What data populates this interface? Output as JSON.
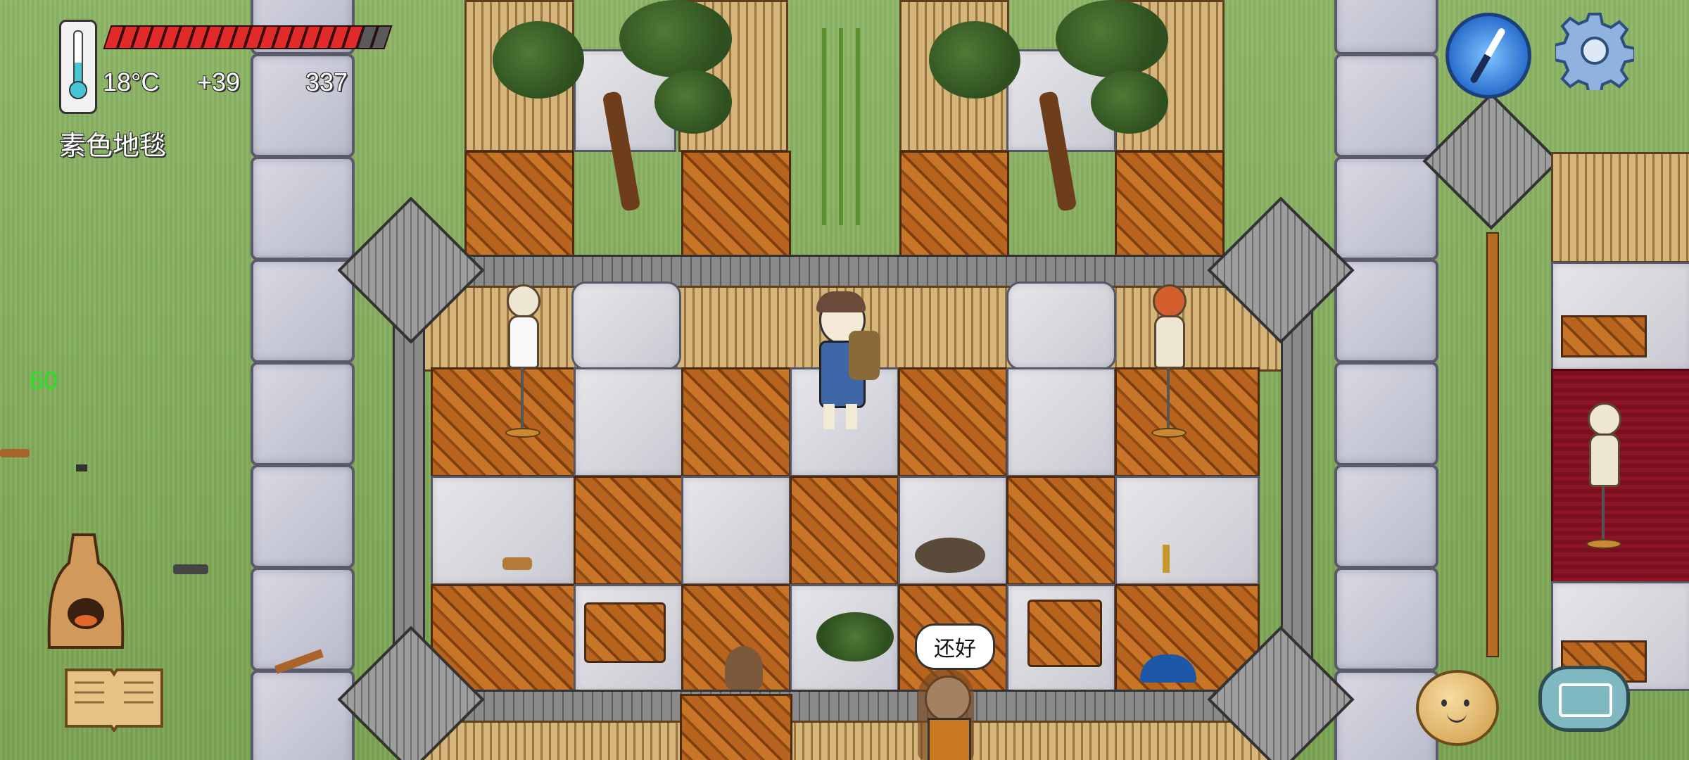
{
  "hud": {
    "temperature": "18°C",
    "bonus": "+39",
    "score": "337",
    "floor_label": "素色地毯",
    "fps": "60",
    "health_fraction": 0.88
  },
  "speech_bubble": "还好",
  "icons": {
    "thermometer": "thermometer-icon",
    "compass": "compass-icon",
    "settings": "gear-icon",
    "keyboard": "keyboard-icon",
    "emote": "emote-icon",
    "recipe_book": "book-icon",
    "kiln": "kiln-icon"
  },
  "colors": {
    "health_fill": "#e12a2a",
    "health_empty": "#5a5a5a",
    "fps": "#27e227",
    "thermo_fill": "#49c6d4"
  }
}
